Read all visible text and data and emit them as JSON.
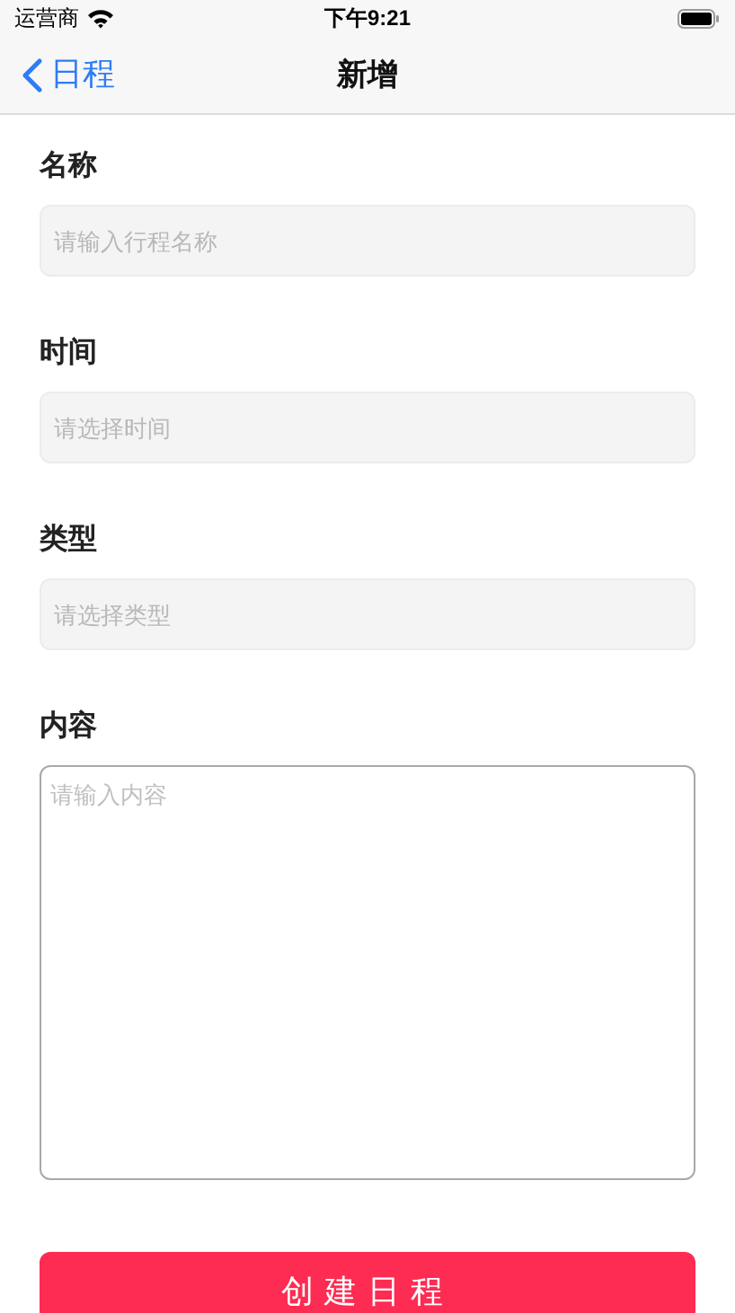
{
  "status_bar": {
    "carrier": "运营商",
    "time": "下午9:21"
  },
  "nav": {
    "back": "日程",
    "title": "新增"
  },
  "fields": [
    {
      "label": "名称",
      "kind": "text",
      "placeholder": "请输入行程名称"
    },
    {
      "label": "时间",
      "kind": "select",
      "placeholder": "请选择时间"
    },
    {
      "label": "类型",
      "kind": "select",
      "placeholder": "请选择类型"
    },
    {
      "label": "内容",
      "kind": "textarea",
      "placeholder": "请输入内容"
    }
  ],
  "submit": "创建日程"
}
